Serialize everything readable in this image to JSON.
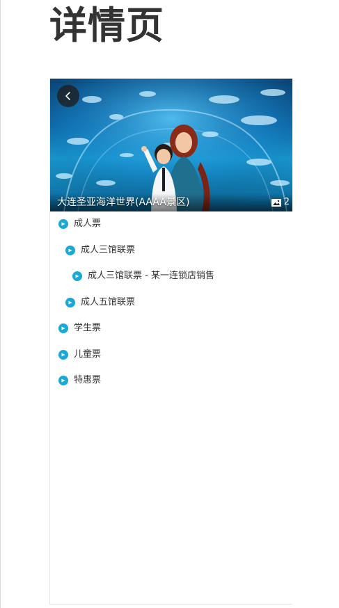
{
  "page": {
    "title": "详情页"
  },
  "hero": {
    "title": "大连圣亚海洋世界(AAAA景区)",
    "photo_count": "2",
    "back_icon": "chevron-left-icon",
    "photo_icon": "image-icon"
  },
  "tree": {
    "icon": "circle-arrow-icon",
    "accent_color": "#19a9d6",
    "items": [
      {
        "label": "成人票",
        "level": 0
      },
      {
        "label": "成人三馆联票",
        "level": 1
      },
      {
        "label": "成人三馆联票 - 某一连锁店销售",
        "level": 2
      },
      {
        "label": "成人五馆联票",
        "level": 1
      },
      {
        "label": "学生票",
        "level": 0
      },
      {
        "label": "儿童票",
        "level": 0
      },
      {
        "label": "特惠票",
        "level": 0
      }
    ]
  }
}
